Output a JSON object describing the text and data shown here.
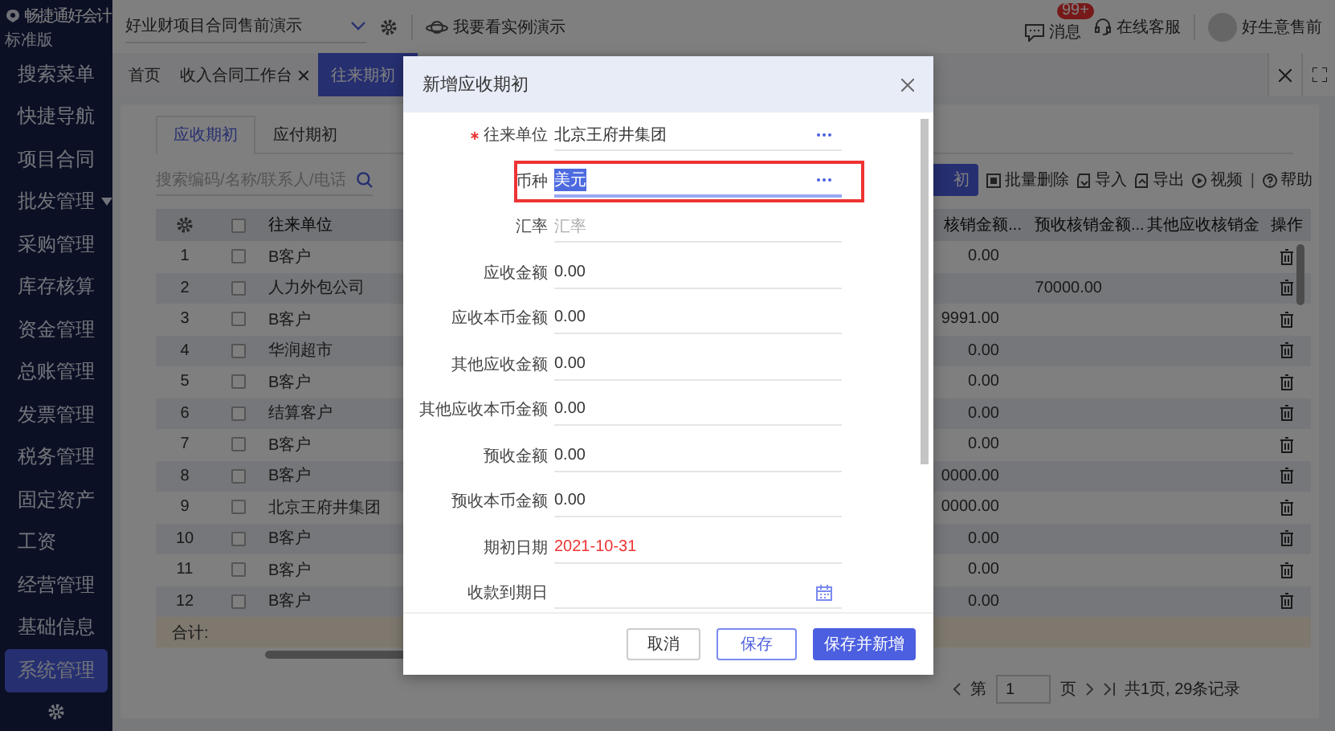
{
  "app": {
    "logo_text": "畅捷通好会计",
    "edition": "标准版"
  },
  "topbar": {
    "account_select": "好业财项目合同售前演示",
    "demo_link": "我要看实例演示",
    "messages": {
      "label": "消息",
      "badge": "99+"
    },
    "support": "在线客服",
    "user": "好生意售前"
  },
  "sidebar": {
    "items": [
      {
        "label": "搜索菜单",
        "selected": false,
        "expandable": false
      },
      {
        "label": "快捷导航",
        "selected": false,
        "expandable": false
      },
      {
        "label": "项目合同",
        "selected": false,
        "expandable": false
      },
      {
        "label": "批发管理",
        "selected": false,
        "expandable": true
      },
      {
        "label": "采购管理",
        "selected": false,
        "expandable": false
      },
      {
        "label": "库存核算",
        "selected": false,
        "expandable": false
      },
      {
        "label": "资金管理",
        "selected": false,
        "expandable": false
      },
      {
        "label": "总账管理",
        "selected": false,
        "expandable": false
      },
      {
        "label": "发票管理",
        "selected": false,
        "expandable": false
      },
      {
        "label": "税务管理",
        "selected": false,
        "expandable": false
      },
      {
        "label": "固定资产",
        "selected": false,
        "expandable": false
      },
      {
        "label": "工资",
        "selected": false,
        "expandable": false
      },
      {
        "label": "经营管理",
        "selected": false,
        "expandable": false
      },
      {
        "label": "基础信息",
        "selected": false,
        "expandable": false
      },
      {
        "label": "系统管理",
        "selected": true,
        "expandable": false
      }
    ]
  },
  "tabs": [
    {
      "label": "首页",
      "selected": false,
      "closable": false
    },
    {
      "label": "收入合同工作台",
      "selected": false,
      "closable": true
    },
    {
      "label": "往来期初",
      "selected": true,
      "closable": false
    }
  ],
  "page": {
    "subtabs": [
      {
        "label": "应收期初",
        "selected": true
      },
      {
        "label": "应付期初",
        "selected": false
      }
    ],
    "search": {
      "placeholder": "搜索编码/名称/联系人/电话"
    },
    "toolbar": {
      "primary_button": "初",
      "actions": [
        "批量删除",
        "导入",
        "导出"
      ],
      "video": "视频",
      "separator": "|",
      "help": "帮助"
    },
    "table": {
      "select_all_checked": false,
      "columns": [
        "往来单位",
        "核销金额...",
        "预收核销金额...",
        "其他应收核销金",
        "操作"
      ],
      "rows": [
        {
          "index": "1",
          "checked": false,
          "unit": "B客户",
          "column_4": "0.00"
        },
        {
          "index": "2",
          "checked": false,
          "unit": "人力外包公司",
          "column_5": "70000.00"
        },
        {
          "index": "3",
          "checked": false,
          "unit": "B客户",
          "column_4": "9991.00"
        },
        {
          "index": "4",
          "checked": false,
          "unit": "华润超市",
          "column_4": "0.00"
        },
        {
          "index": "5",
          "checked": false,
          "unit": "B客户",
          "column_4": "0.00"
        },
        {
          "index": "6",
          "checked": false,
          "unit": "结算客户",
          "column_4": "0.00"
        },
        {
          "index": "7",
          "checked": false,
          "unit": "B客户",
          "column_4": "0.00"
        },
        {
          "index": "8",
          "checked": false,
          "unit": "B客户",
          "column_4": "0000.00"
        },
        {
          "index": "9",
          "checked": false,
          "unit": "北京王府井集团",
          "column_4": "0000.00"
        },
        {
          "index": "10",
          "checked": false,
          "unit": "B客户",
          "column_4": "0.00"
        },
        {
          "index": "11",
          "checked": false,
          "unit": "B客户",
          "column_4": "0.00"
        },
        {
          "index": "12",
          "checked": false,
          "unit": "B客户",
          "column_4": "0.00"
        }
      ],
      "footer": "合计:"
    },
    "pagination": {
      "before": "第",
      "page": "1",
      "after": "页",
      "summary": "共1页, 29条记录"
    }
  },
  "dialog": {
    "title": "新增应收期初",
    "fields": [
      {
        "label": "往来单位",
        "required": true,
        "kind": "reference",
        "value": "北京王府井集团",
        "highlighted": false,
        "focused": false
      },
      {
        "label": "币种",
        "required": false,
        "kind": "reference",
        "value": "美元",
        "highlighted": true,
        "focused": true
      },
      {
        "label": "汇率",
        "required": false,
        "kind": "input",
        "placeholder": "汇率",
        "highlighted": false,
        "focused": false
      },
      {
        "label": "应收金额",
        "required": false,
        "kind": "input",
        "value": "0.00",
        "highlighted": false,
        "focused": false
      },
      {
        "label": "应收本币金额",
        "required": false,
        "kind": "input",
        "value": "0.00",
        "highlighted": false,
        "focused": false
      },
      {
        "label": "其他应收金额",
        "required": false,
        "kind": "input",
        "value": "0.00",
        "highlighted": false,
        "focused": false
      },
      {
        "label": "其他应收本币金额",
        "required": false,
        "kind": "input",
        "value": "0.00",
        "highlighted": false,
        "focused": false
      },
      {
        "label": "预收金额",
        "required": false,
        "kind": "input",
        "value": "0.00",
        "highlighted": false,
        "focused": false
      },
      {
        "label": "预收本币金额",
        "required": false,
        "kind": "input",
        "value": "0.00",
        "highlighted": false,
        "focused": false
      },
      {
        "label": "期初日期",
        "required": false,
        "kind": "readonly",
        "value": "2021-10-31",
        "highlighted": false,
        "focused": false
      },
      {
        "label": "收款到期日",
        "required": false,
        "kind": "date",
        "highlighted": false,
        "focused": false
      }
    ],
    "buttons": [
      {
        "label": "取消",
        "kind": "default"
      },
      {
        "label": "保存",
        "kind": "outline"
      },
      {
        "label": "保存并新增",
        "kind": "primary"
      }
    ]
  }
}
